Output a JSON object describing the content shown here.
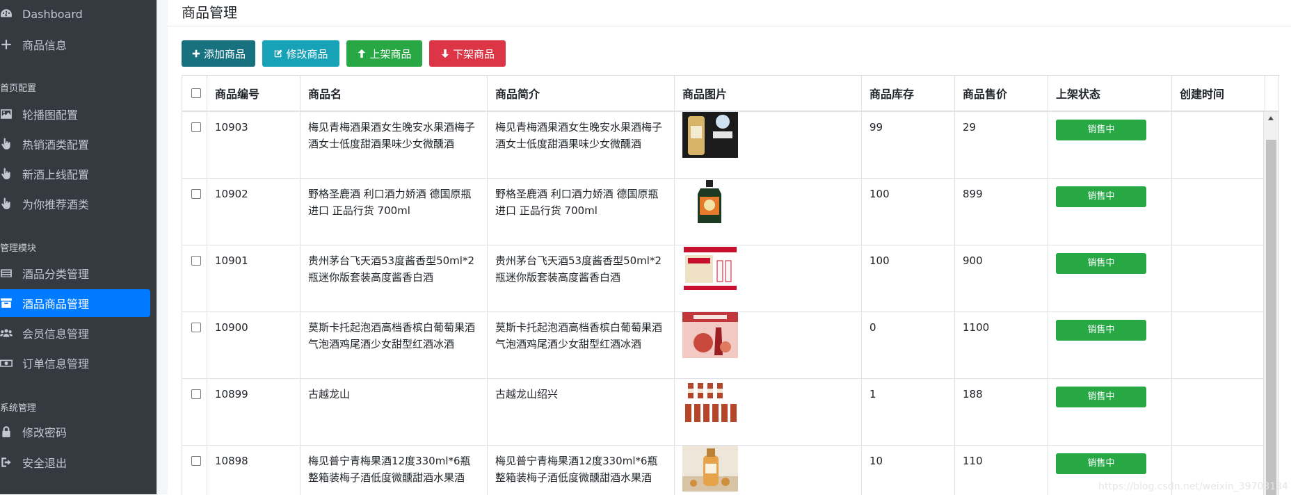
{
  "sidebar": {
    "items_top": [
      {
        "label": "Dashboard",
        "icon": "dashboard-icon"
      },
      {
        "label": "商品信息",
        "icon": "plus-icon"
      }
    ],
    "headers": [
      "首页配置",
      "管理模块",
      "系统管理"
    ],
    "config_items": [
      {
        "label": "轮播图配置",
        "icon": "image-icon"
      },
      {
        "label": "热销酒类配置",
        "icon": "hand-pointer-icon"
      },
      {
        "label": "新酒上线配置",
        "icon": "hand-pointer-icon"
      },
      {
        "label": "为你推荐酒类",
        "icon": "hand-pointer-icon"
      }
    ],
    "manage_items": [
      {
        "label": "酒品分类管理",
        "icon": "list-icon"
      },
      {
        "label": "酒品商品管理",
        "icon": "box-icon",
        "active": true
      },
      {
        "label": "会员信息管理",
        "icon": "users-icon"
      },
      {
        "label": "订单信息管理",
        "icon": "money-icon"
      }
    ],
    "system_items": [
      {
        "label": "修改密码",
        "icon": "lock-icon"
      },
      {
        "label": "安全退出",
        "icon": "sign-out-icon"
      }
    ]
  },
  "page": {
    "title": "商品管理"
  },
  "toolbar": {
    "add": "添加商品",
    "edit": "修改商品",
    "up": "上架商品",
    "down": "下架商品"
  },
  "table": {
    "columns": [
      "商品编号",
      "商品名",
      "商品简介",
      "商品图片",
      "商品库存",
      "商品售价",
      "上架状态",
      "创建时间"
    ],
    "rows": [
      {
        "id": "10903",
        "name": "梅见青梅酒果酒女生晚安水果酒梅子酒女士低度甜酒果味少女微醺酒",
        "intro": "梅见青梅酒果酒女生晚安水果酒梅子酒女士低度甜酒果味少女微醺酒",
        "stock": "99",
        "price": "29",
        "status": "销售中",
        "created": ""
      },
      {
        "id": "10902",
        "name": "野格圣鹿酒 利口酒力娇酒 德国原瓶进口 正品行货 700ml",
        "intro": "野格圣鹿酒 利口酒力娇酒 德国原瓶进口 正品行货 700ml",
        "stock": "100",
        "price": "899",
        "status": "销售中",
        "created": ""
      },
      {
        "id": "10901",
        "name": "贵州茅台飞天酒53度酱香型50ml*2瓶迷你版套装高度酱香白酒",
        "intro": "贵州茅台飞天酒53度酱香型50ml*2瓶迷你版套装高度酱香白酒",
        "stock": "100",
        "price": "900",
        "status": "销售中",
        "created": ""
      },
      {
        "id": "10900",
        "name": "莫斯卡托起泡酒高档香槟白葡萄果酒气泡酒鸡尾酒少女甜型红酒冰酒",
        "intro": "莫斯卡托起泡酒高档香槟白葡萄果酒气泡酒鸡尾酒少女甜型红酒冰酒",
        "stock": "0",
        "price": "1100",
        "status": "销售中",
        "created": ""
      },
      {
        "id": "10899",
        "name": "古越龙山",
        "intro": "古越龙山绍兴",
        "stock": "1",
        "price": "188",
        "status": "销售中",
        "created": ""
      },
      {
        "id": "10898",
        "name": "梅见普宁青梅果酒12度330ml*6瓶整箱装梅子酒低度微醺甜酒水果酒",
        "intro": "梅见普宁青梅果酒12度330ml*6瓶整箱装梅子酒低度微醺甜酒水果酒",
        "stock": "10",
        "price": "110",
        "status": "销售中",
        "created": ""
      }
    ]
  },
  "watermark": "https://blog.csdn.net/weixin_39703134",
  "colors": {
    "sidebar_bg": "#343a40",
    "active": "#007bff",
    "success": "#28a745",
    "danger": "#dc3545",
    "info": "#17a2b8"
  }
}
